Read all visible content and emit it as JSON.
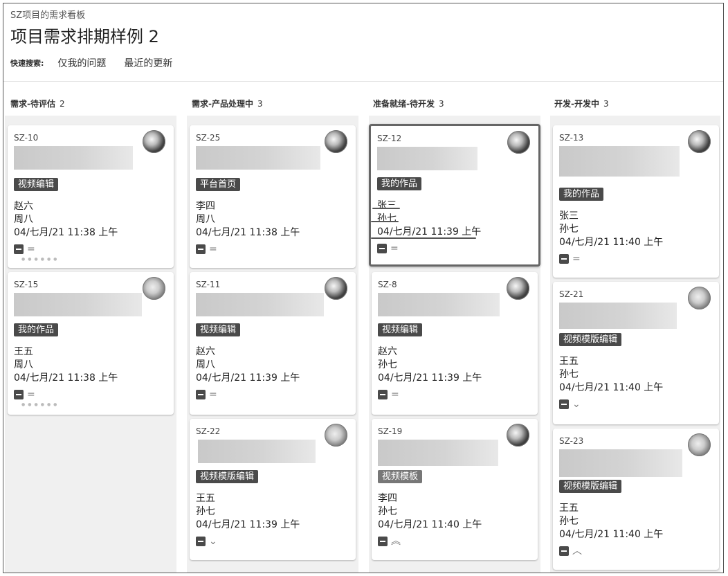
{
  "breadcrumb": "SZ项目的需求看板",
  "title": "项目需求排期样例 2",
  "quick_filters": {
    "label": "快速搜索:",
    "links": [
      "仅我的问题",
      "最近的更新"
    ]
  },
  "columns": [
    {
      "name": "需求-待评估",
      "count": "2",
      "cards": [
        {
          "key": "SZ-10",
          "tag": "视频编辑",
          "assignee": "赵六",
          "reporter": "周八",
          "date": "04/七月/21 11:38 上午",
          "priority_icon": "="
        },
        {
          "key": "SZ-15",
          "tag": "我的作品",
          "assignee": "王五",
          "reporter": "周八",
          "date": "04/七月/21 11:38 上午",
          "priority_icon": "="
        }
      ]
    },
    {
      "name": "需求-产品处理中",
      "count": "3",
      "cards": [
        {
          "key": "SZ-25",
          "tag": "平台首页",
          "assignee": "李四",
          "reporter": "周八",
          "date": "04/七月/21 11:38 上午",
          "priority_icon": "="
        },
        {
          "key": "SZ-11",
          "tag": "视频编辑",
          "assignee": "赵六",
          "reporter": "周八",
          "date": "04/七月/21 11:39 上午",
          "priority_icon": "="
        },
        {
          "key": "SZ-22",
          "tag": "视频模版编辑",
          "assignee": "王五",
          "reporter": "孙七",
          "date": "04/七月/21 11:39 上午",
          "priority_icon": "⌄"
        }
      ]
    },
    {
      "name": "准备就绪-待开发",
      "count": "3",
      "cards": [
        {
          "key": "SZ-12",
          "tag": "我的作品",
          "assignee": "张三",
          "reporter": "孙七",
          "date": "04/七月/21 11:39 上午",
          "priority_icon": "="
        },
        {
          "key": "SZ-8",
          "tag": "视频编辑",
          "assignee": "赵六",
          "reporter": "孙七",
          "date": "04/七月/21 11:39 上午",
          "priority_icon": "="
        },
        {
          "key": "SZ-19",
          "tag": "视频模板",
          "assignee": "李四",
          "reporter": "孙七",
          "date": "04/七月/21 11:40 上午",
          "priority_icon": "︽"
        }
      ]
    },
    {
      "name": "开发-开发中",
      "count": "3",
      "cards": [
        {
          "key": "SZ-13",
          "tag": "我的作品",
          "assignee": "张三",
          "reporter": "孙七",
          "date": "04/七月/21 11:40 上午",
          "priority_icon": "="
        },
        {
          "key": "SZ-21",
          "tag": "视频模版编辑",
          "assignee": "王五",
          "reporter": "孙七",
          "date": "04/七月/21 11:40 上午",
          "priority_icon": "⌄"
        },
        {
          "key": "SZ-23",
          "tag": "视频模版编辑",
          "assignee": "王五",
          "reporter": "孙七",
          "date": "04/七月/21 11:40 上午",
          "priority_icon": "︿"
        }
      ]
    }
  ]
}
